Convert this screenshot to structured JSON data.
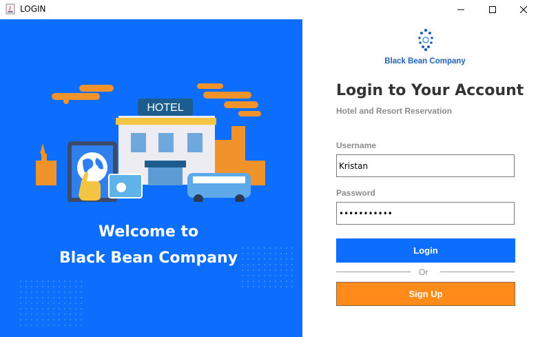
{
  "window": {
    "title": "LOGIN",
    "minimize_icon": "minimize-icon",
    "maximize_icon": "maximize-icon",
    "close_icon": "close-icon"
  },
  "left_panel": {
    "background_color": "#0d6efd",
    "illustration_sign": "HOTEL",
    "welcome_line1": "Welcome to",
    "welcome_line2": "Black Bean Company"
  },
  "right_panel": {
    "company_name": "Black Bean Company",
    "heading": "Login to Your Account",
    "subheading": "Hotel and Resort Reservation",
    "username_label": "Username",
    "username_value": "Kristan",
    "password_label": "Password",
    "password_value": "•••••••••••",
    "login_button": "Login",
    "or_text": "Or",
    "signup_button": "Sign Up",
    "login_color": "#0d6efd",
    "signup_color": "#ff8c1a"
  }
}
